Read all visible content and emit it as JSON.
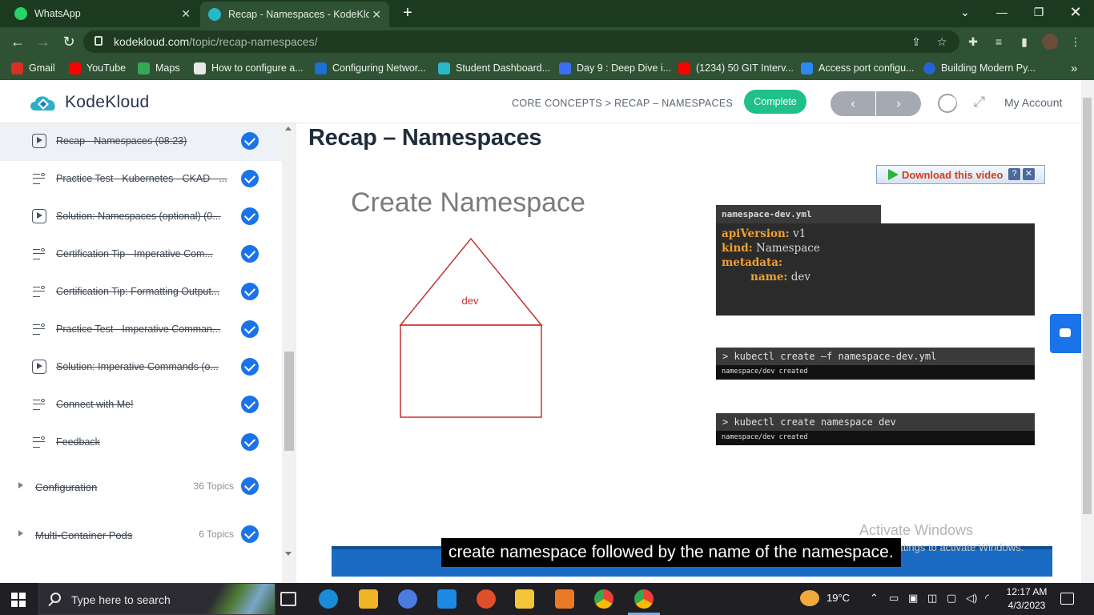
{
  "browser": {
    "tabs": [
      {
        "label": "WhatsApp",
        "icon": "whatsapp-icon"
      },
      {
        "label": "Recap - Namespaces - KodeKlou",
        "icon": "kodekloud-icon"
      }
    ],
    "url_host": "kodekloud.com",
    "url_path": "/topic/recap-namespaces/",
    "bookmarks": [
      {
        "label": "Gmail",
        "icon": "gmail-icon",
        "color": "#d93025"
      },
      {
        "label": "YouTube",
        "icon": "youtube-icon",
        "color": "#ff0000"
      },
      {
        "label": "Maps",
        "icon": "maps-icon",
        "color": "#34a853"
      },
      {
        "label": "How to configure a...",
        "icon": "page-icon",
        "color": "#e8e8e8"
      },
      {
        "label": "Configuring Networ...",
        "icon": "vmware-icon",
        "color": "#1d6fd3"
      },
      {
        "label": "Student Dashboard...",
        "icon": "cloud-icon",
        "color": "#29b6c9"
      },
      {
        "label": "Day 9 : Deep Dive i...",
        "icon": "diamond-icon",
        "color": "#3b6ef0"
      },
      {
        "label": "(1234) 50 GIT Interv...",
        "icon": "youtube-icon",
        "color": "#ff0000"
      },
      {
        "label": "Access port configu...",
        "icon": "link-icon",
        "color": "#2a8af0"
      },
      {
        "label": "Building Modern Py...",
        "icon": "c-icon",
        "color": "#2463d6"
      }
    ]
  },
  "header": {
    "logo_text": "KodeKloud",
    "breadcrumb": "CORE CONCEPTS > RECAP – NAMESPACES",
    "complete_label": "Complete",
    "prev_label": "‹",
    "next_label": "›",
    "account_label": "My Account",
    "accent": "#1fc08b"
  },
  "sidebar": {
    "items": [
      {
        "label": "Recap - Namespaces (08:23)",
        "type": "video",
        "active": true
      },
      {
        "label": "Practice Test - Kubernetes - CKAD - ...",
        "type": "doc"
      },
      {
        "label": "Solution: Namespaces (optional) (0...",
        "type": "video"
      },
      {
        "label": "Certification Tip - Imperative Com...",
        "type": "doc"
      },
      {
        "label": "Certification Tip: Formatting Output...",
        "type": "doc"
      },
      {
        "label": "Practice Test - Imperative Comman...",
        "type": "doc"
      },
      {
        "label": "Solution: Imperative Commands (o...",
        "type": "video"
      },
      {
        "label": "Connect with Me!",
        "type": "doc"
      },
      {
        "label": "Feedback",
        "type": "doc"
      }
    ],
    "sections": [
      {
        "label": "Configuration",
        "count": "36 Topics"
      },
      {
        "label": "Multi-Container Pods",
        "count": "6 Topics"
      }
    ]
  },
  "content": {
    "page_title": "Recap – Namespaces",
    "slide_title": "Create Namespace",
    "house_label": "dev",
    "yaml_file": "namespace-dev.yml",
    "yaml_lines": [
      {
        "key": "apiVersion:",
        "value": "v1",
        "indent": false
      },
      {
        "key": "kind:",
        "value": "Namespace",
        "indent": false
      },
      {
        "key": "metadata:",
        "value": "",
        "indent": false
      },
      {
        "key": "name:",
        "value": "dev",
        "indent": true
      }
    ],
    "terminal1": {
      "cmd": "> kubectl create –f namespace-dev.yml",
      "out": "namespace/dev created"
    },
    "terminal2": {
      "cmd": "> kubectl create namespace dev",
      "out": "namespace/dev created"
    },
    "download_label": "Download this video",
    "caption": "create namespace followed by the name of the namespace.",
    "watermark_line1": "Activate Windows",
    "watermark_line2": "Go to Settings to activate Windows."
  },
  "taskbar": {
    "search_placeholder": "Type here to search",
    "weather": "19°C",
    "time": "12:17 AM",
    "date": "4/3/2023"
  }
}
